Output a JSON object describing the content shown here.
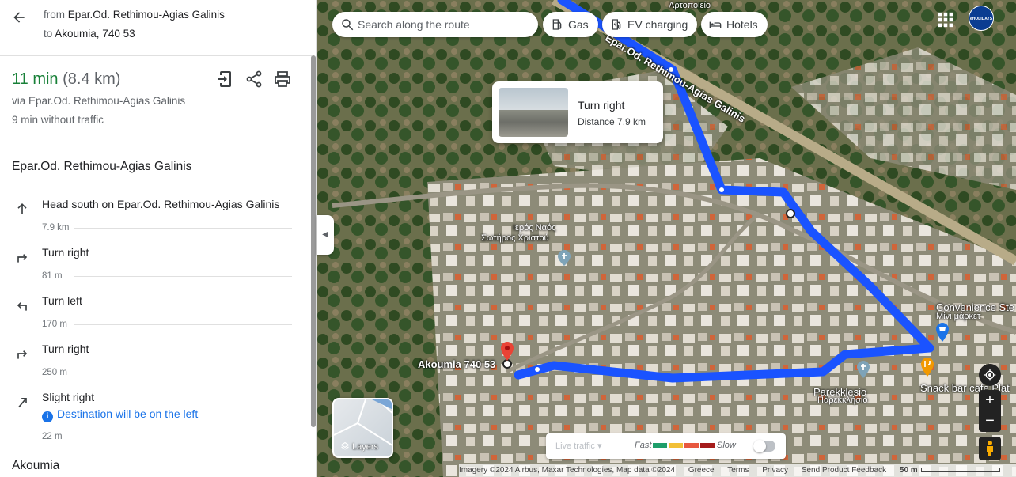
{
  "route": {
    "from_prefix": "from",
    "from_place": "Epar.Od. Rethimou-Agias Galinis",
    "to_prefix": "to",
    "to_place": "Akoumia, 740 53"
  },
  "summary": {
    "duration": "11 min",
    "distance": "(8.4 km)",
    "via": "via Epar.Od. Rethimou-Agias Galinis",
    "without_traffic": "9 min without traffic"
  },
  "steps_section_title": "Epar.Od. Rethimou-Agias Galinis",
  "steps": [
    {
      "icon": "arrow-up-icon",
      "text": "Head south on Epar.Od. Rethimou-Agias Galinis",
      "distance": "7.9 km"
    },
    {
      "icon": "turn-right-icon",
      "text": "Turn right",
      "distance": "81 m"
    },
    {
      "icon": "turn-left-icon",
      "text": "Turn left",
      "distance": "170 m"
    },
    {
      "icon": "turn-right-icon",
      "text": "Turn right",
      "distance": "250 m"
    },
    {
      "icon": "slight-right-icon",
      "text": "Slight right",
      "note": "Destination will be on the left",
      "distance": "22 m"
    }
  ],
  "destination_title": "Akoumia",
  "search": {
    "placeholder": "Search along the route"
  },
  "chips": {
    "gas": "Gas",
    "ev": "EV charging",
    "hotels": "Hotels"
  },
  "account_label": "eHOLIDAYS",
  "popup": {
    "title": "Turn right",
    "subtitle": "Distance 7.9 km"
  },
  "map_labels": {
    "top": "Αρτοποιείο",
    "road": "Epar.Od. Rethimou-Agias Galinis",
    "church_gr1": "Ιερός Ναός",
    "church_gr2": "Σωτήρος Χριστού",
    "destination": "Akoumia 740 53",
    "convenience": "Convenience Ste",
    "convenience_gr": "Μίνι μάρκετ",
    "parekklesio": "Parekklesio",
    "parekklesio_gr": "Παρεκκλήσιο",
    "snack": "Snack bar cafe Plat"
  },
  "layers_label": "Layers",
  "traffic": {
    "select": "Live traffic",
    "fast": "Fast",
    "slow": "Slow",
    "colors": [
      "#1e9e6a",
      "#f2c037",
      "#e8583f",
      "#a51c1c"
    ]
  },
  "attribution": {
    "imagery": "Imagery ©2024 Airbus, Maxar Technologies, Map data ©2024",
    "country": "Greece",
    "terms": "Terms",
    "privacy": "Privacy",
    "feedback": "Send Product Feedback",
    "scale": "50 m"
  },
  "colors": {
    "route": "#1a53ff",
    "duration": "#188038",
    "link": "#1a73e8"
  }
}
